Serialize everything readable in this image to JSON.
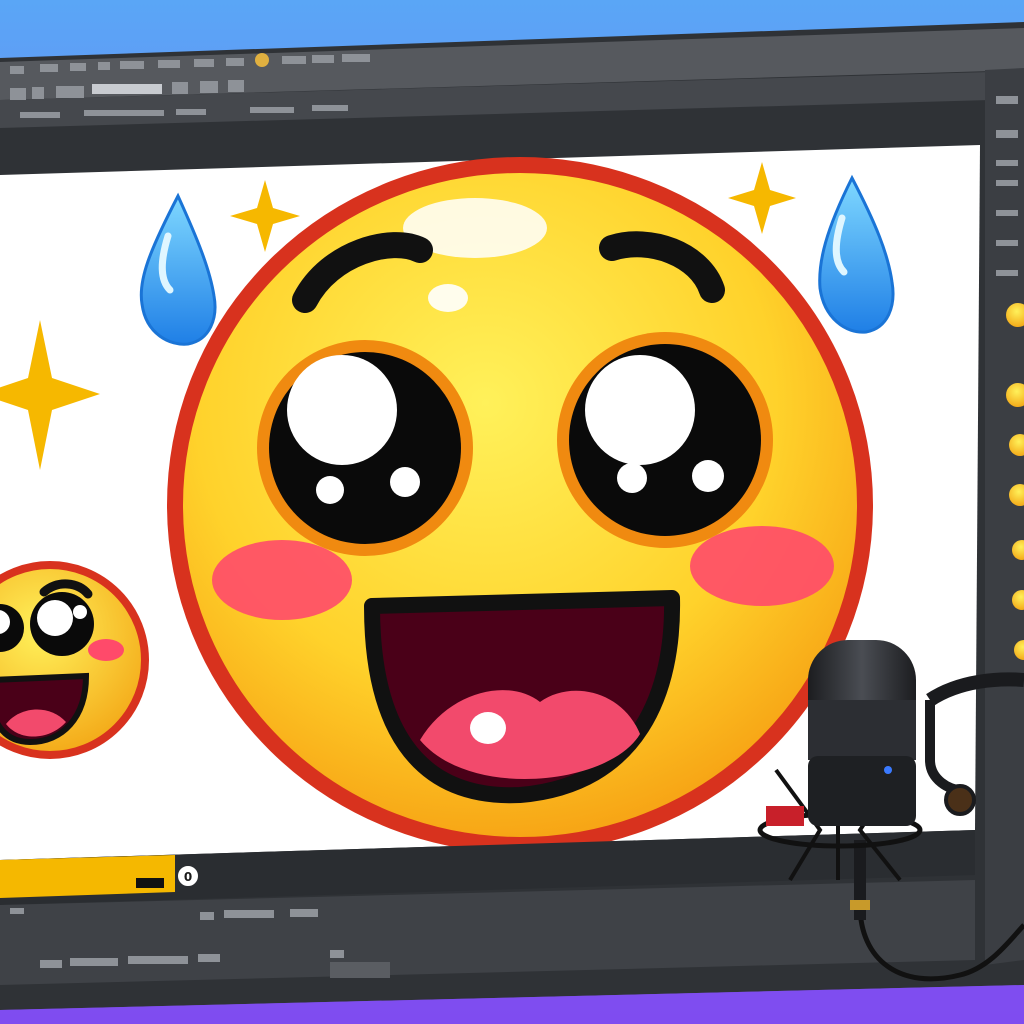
{
  "scene": {
    "kind": "photo-like illustration of a graphics editor on a monitor with a condenser microphone",
    "colors": {
      "background_top": "#5aa6f6",
      "background_bottom": "#8a4ff0",
      "monitor_frame": "#3a3d42",
      "toolbar": "#4a4d52",
      "canvas": "#ffffff",
      "emoji_face": "#ffd93b",
      "emoji_outline": "#d8321e",
      "cheek": "#ff4a6a",
      "tear": "#3aa0f0",
      "sparkle": "#f6b800",
      "timeline_accent": "#f5b800",
      "microphone": "#2a2c30"
    }
  },
  "ui": {
    "layer_badge": "0"
  },
  "icons": [
    "emoji-face-icon",
    "sparkle-icon",
    "teardrop-icon",
    "microphone-icon"
  ]
}
